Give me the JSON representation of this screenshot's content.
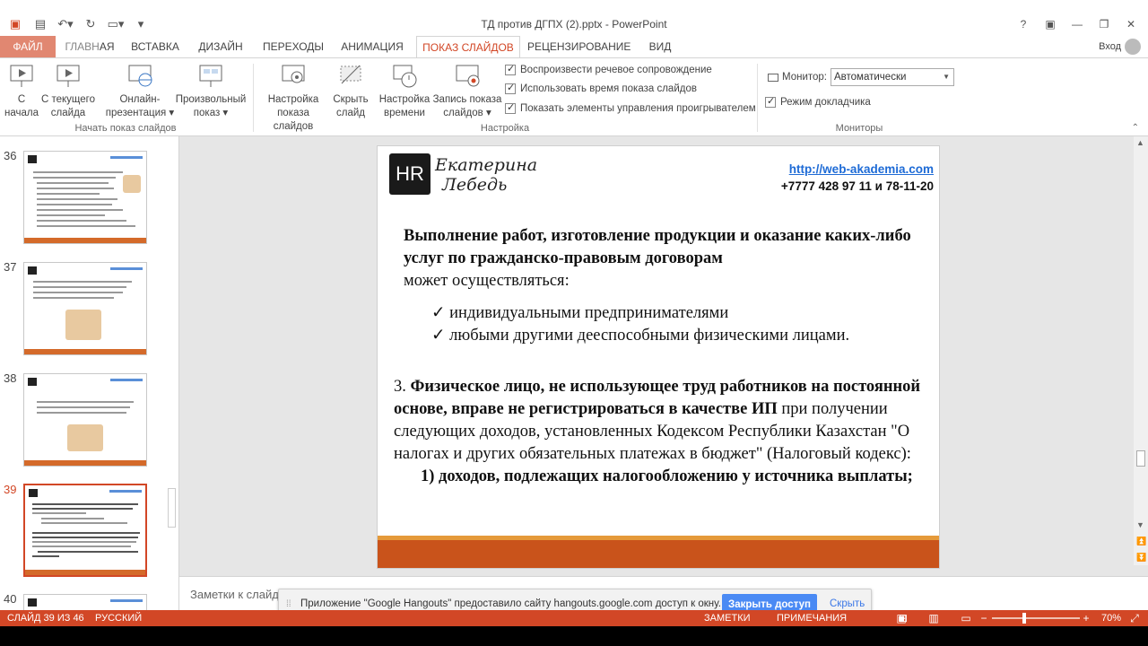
{
  "window": {
    "title": "ТД против ДГПХ (2).pptx - PowerPoint",
    "help": "?",
    "login": "Вход"
  },
  "tabs": {
    "file": "ФАЙЛ",
    "items": [
      "ГЛАВНАЯ",
      "ВСТАВКА",
      "ДИЗАЙН",
      "ПЕРЕХОДЫ",
      "АНИМАЦИЯ",
      "ПОКАЗ СЛАЙДОВ",
      "РЕЦЕНЗИРОВАНИЕ",
      "ВИД"
    ],
    "active": "ПОКАЗ СЛАЙДОВ"
  },
  "ribbon": {
    "start_group": {
      "label": "Начать показ слайдов",
      "from_start": [
        "С",
        "начала"
      ],
      "from_current": [
        "С текущего",
        "слайда"
      ],
      "online": [
        "Онлайн-",
        "презентация ▾"
      ],
      "custom": [
        "Произвольный",
        "показ ▾"
      ]
    },
    "setup_group": {
      "label": "Настройка",
      "setup_show": [
        "Настройка",
        "показа слайдов"
      ],
      "hide_slide": [
        "Скрыть",
        "слайд"
      ],
      "rehearse": [
        "Настройка",
        "времени"
      ],
      "record": [
        "Запись показа",
        "слайдов ▾"
      ],
      "checks": [
        "Воспроизвести речевое сопровождение",
        "Использовать время показа слайдов",
        "Показать элементы управления проигрывателем"
      ]
    },
    "monitors_group": {
      "label": "Мониторы",
      "monitor_label": "Монитор:",
      "monitor_value": "Автоматически",
      "presenter_view": "Режим докладчика"
    }
  },
  "thumbnails": [
    {
      "num": "36"
    },
    {
      "num": "37"
    },
    {
      "num": "38"
    },
    {
      "num": "39",
      "selected": true
    },
    {
      "num": "40"
    }
  ],
  "slide": {
    "logo_letters": "HR",
    "logo_name_line1": "Екатерина",
    "logo_name_line2": "Лебедь",
    "link": "http://web-akademia.com",
    "phone": "+7777 428 97 11 и 78-11-20",
    "p1_bold": "Выполнение работ, изготовление продукции и оказание каких-либо услуг по гражданско-правовым договорам",
    "p1_rest": "может осуществляться:",
    "bullets": [
      "индивидуальными предпринимателями",
      "любыми другими дееспособными физическими лицами."
    ],
    "p3_num": "3. ",
    "p3_bold": "Физическое лицо, не использующее труд работников на постоянной основе, вправе не регистрироваться в качестве ИП",
    "p3_rest": " при получении следующих доходов, установленных Кодексом Республики Казахстан \"О налогах и других обязательных платежах в бюджет\" (Налоговый кодекс):",
    "p4_bold": "1) доходов, подлежащих налогообложению у источника выплаты;"
  },
  "notes_placeholder": "Заметки к слайду",
  "infobar": {
    "message": "Приложение \"Google Hangouts\" предоставило сайту hangouts.google.com доступ к окну.",
    "close_access": "Закрыть доступ",
    "hide": "Скрыть"
  },
  "status": {
    "slide_info": "СЛАЙД 39 ИЗ 46",
    "language": "РУССКИЙ",
    "notes": "ЗАМЕТКИ",
    "comments": "ПРИМЕЧАНИЯ",
    "zoom": "70%"
  },
  "colors": {
    "accent": "#d24726",
    "link": "#1e6bd6",
    "slide_footer": "#c9531b",
    "infobar_button": "#4a8af4"
  }
}
